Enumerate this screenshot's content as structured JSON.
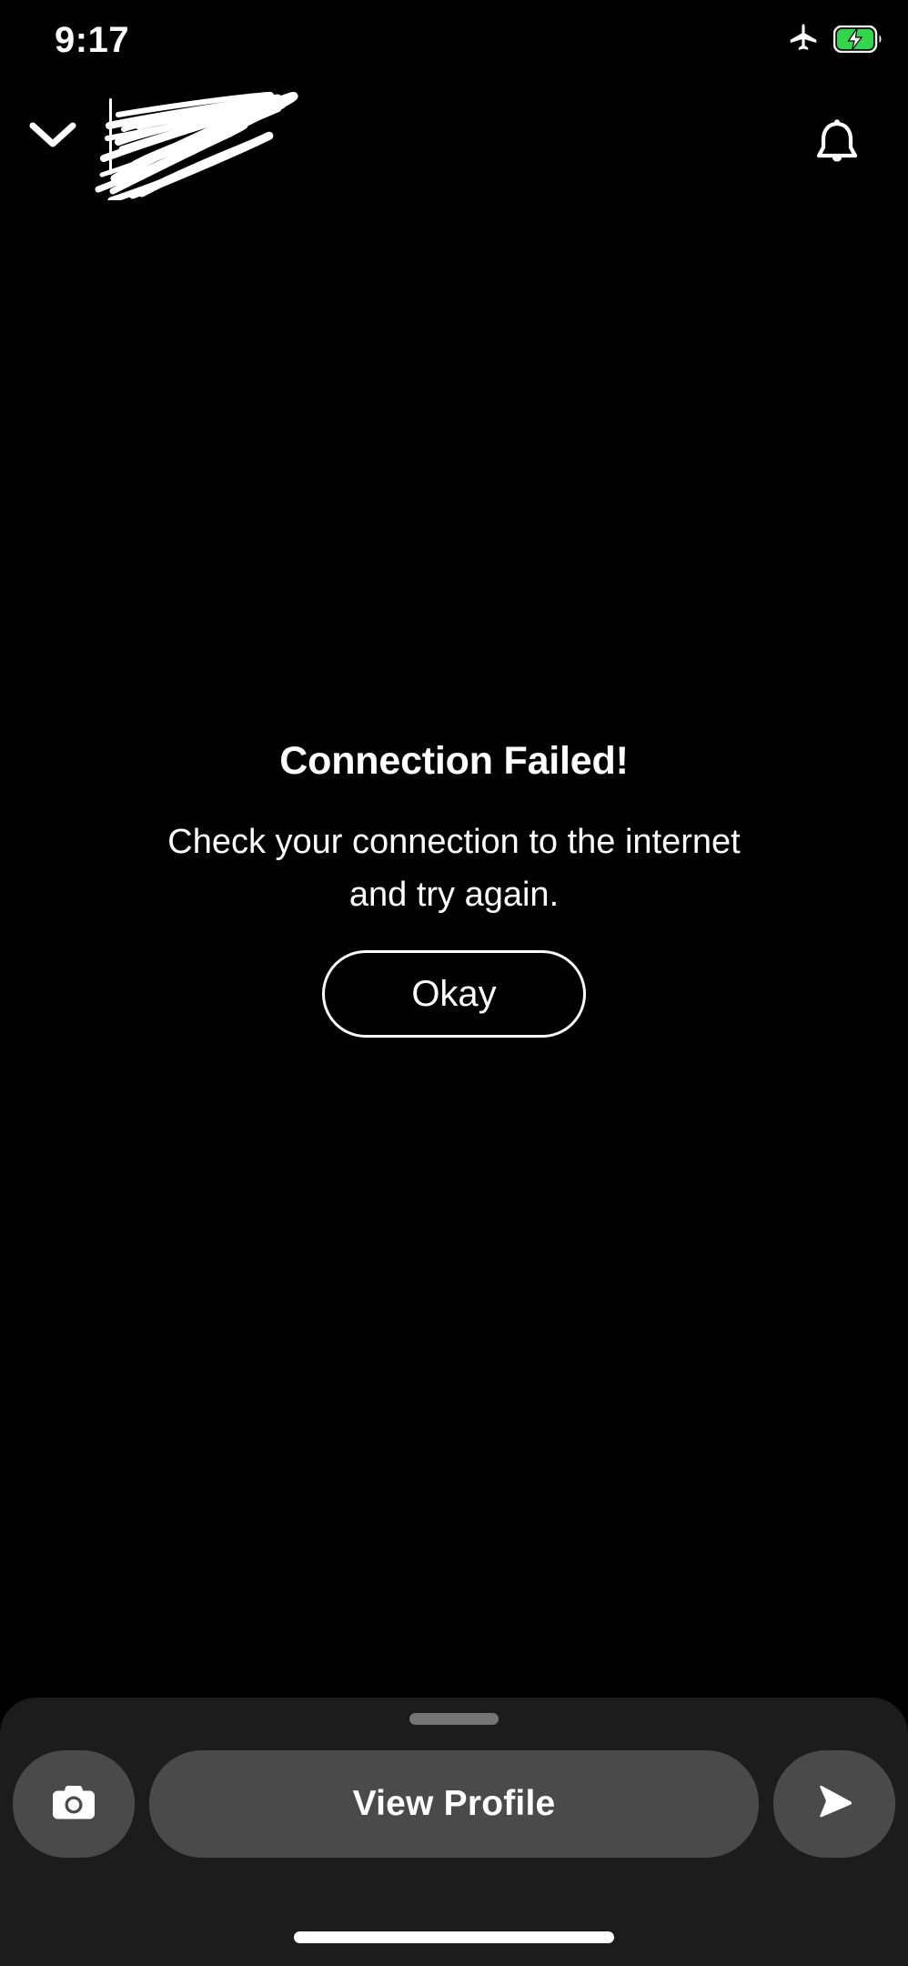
{
  "status_bar": {
    "time": "9:17",
    "airplane_icon": "airplane-mode-icon",
    "battery_icon": "battery-charging-icon",
    "battery_color": "#33d64a"
  },
  "top_nav": {
    "back_icon": "chevron-down-icon",
    "title_redacted": "",
    "redaction_note": "scribble-redaction",
    "notifications_icon": "bell-icon"
  },
  "dialog": {
    "title": "Connection Failed!",
    "message": "Check your connection to the internet and try again.",
    "confirm_label": "Okay"
  },
  "bottom_sheet": {
    "handle": "drag-handle",
    "camera_icon": "camera-icon",
    "primary_label": "View Profile",
    "send_icon": "send-arrow-icon",
    "sheet_bg": "#1c1c1c",
    "pill_bg": "#4a4a4a"
  },
  "system": {
    "home_indicator": "home-indicator"
  }
}
